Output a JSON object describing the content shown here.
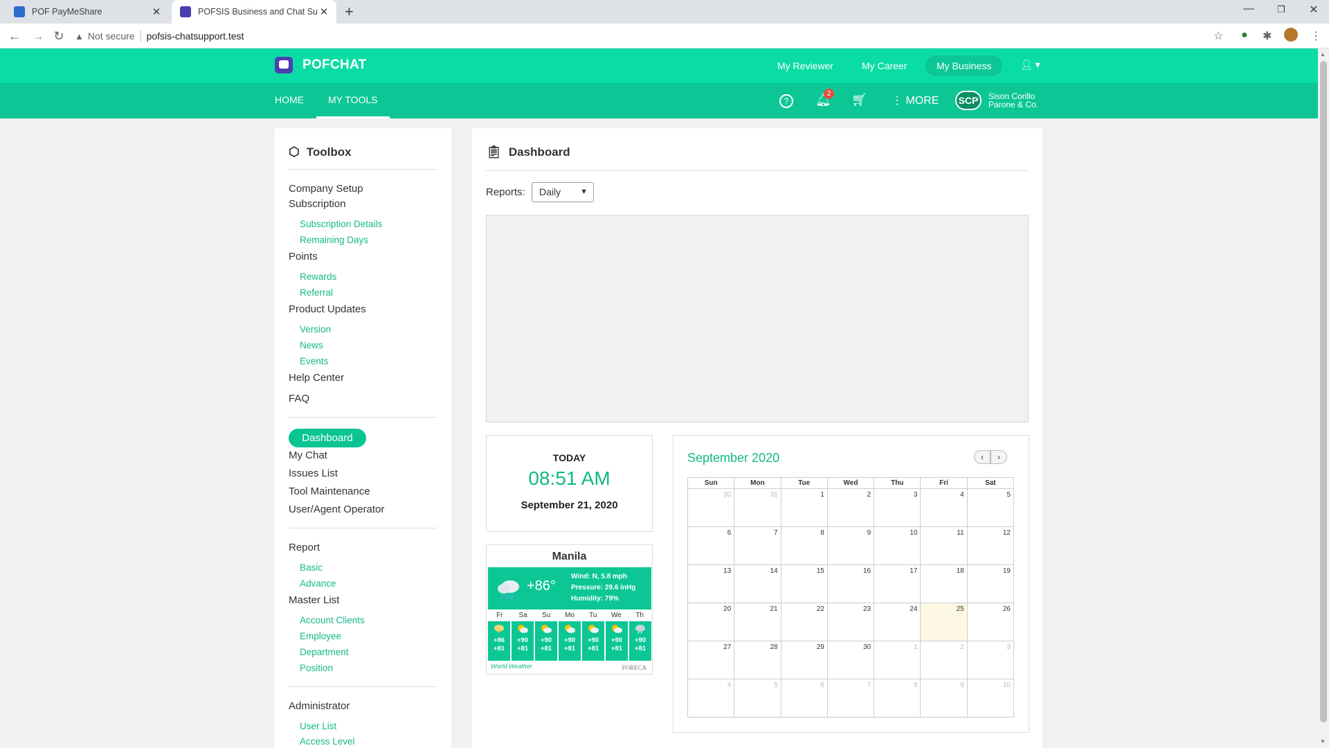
{
  "browser": {
    "tabs": [
      {
        "title": "POF PayMeShare"
      },
      {
        "title": "POFSIS Business and Chat Support"
      }
    ],
    "not_secure": "Not secure",
    "url": "pofsis-chatsupport.test"
  },
  "header": {
    "brand": "POFCHAT",
    "top_nav": [
      "My Reviewer",
      "My Career",
      "My Business"
    ],
    "sub_nav": [
      "HOME",
      "MY TOOLS"
    ],
    "notification_count": "2",
    "more": "MORE",
    "company_initials": "SCP",
    "company_name_1": "Sison Corillo",
    "company_name_2": "Parone & Co."
  },
  "sidebar": {
    "title": "Toolbox",
    "company_setup": "Company Setup",
    "subscription": "Subscription",
    "subscription_details": "Subscription Details",
    "remaining_days": "Remaining Days",
    "points": "Points",
    "rewards": "Rewards",
    "referral": "Referral",
    "product_updates": "Product Updates",
    "version": "Version",
    "news": "News",
    "events": "Events",
    "help_center": "Help Center",
    "faq": "FAQ",
    "dashboard": "Dashboard",
    "my_chat": "My Chat",
    "issues_list": "Issues List",
    "tool_maintenance": "Tool Maintenance",
    "user_agent_operator": "User/Agent Operator",
    "report": "Report",
    "basic": "Basic",
    "advance": "Advance",
    "master_list": "Master List",
    "account_clients": "Account Clients",
    "employee": "Employee",
    "department": "Department",
    "position": "Position",
    "administrator": "Administrator",
    "user_list": "User List",
    "access_level": "Access Level"
  },
  "main": {
    "title": "Dashboard",
    "reports_label": "Reports:",
    "reports_value": "Daily",
    "today_label": "TODAY",
    "today_time": "08:51 AM",
    "today_date": "September 21, 2020"
  },
  "weather": {
    "city": "Manila",
    "temp": "+86°",
    "wind": "Wind: N, 5.8 mph",
    "pressure": "Pressure: 29.6 inHg",
    "humidity": "Humidity: 79%",
    "days": [
      "Fr",
      "Sa",
      "Su",
      "Mo",
      "Tu",
      "We",
      "Th"
    ],
    "highs": [
      "+86",
      "+90",
      "+90",
      "+90",
      "+90",
      "+90",
      "+90"
    ],
    "lows": [
      "+81",
      "+81",
      "+81",
      "+81",
      "+81",
      "+81",
      "+81"
    ],
    "footer_left": "World Weather",
    "footer_right": "FORECA",
    "accent": "#0cc795"
  },
  "calendar": {
    "title": "September 2020",
    "weekdays": [
      "Sun",
      "Mon",
      "Tue",
      "Wed",
      "Thu",
      "Fri",
      "Sat"
    ],
    "weeks": [
      [
        "30",
        "31",
        "1",
        "2",
        "3",
        "4",
        "5"
      ],
      [
        "6",
        "7",
        "8",
        "9",
        "10",
        "11",
        "12"
      ],
      [
        "13",
        "14",
        "15",
        "16",
        "17",
        "18",
        "19"
      ],
      [
        "20",
        "21",
        "22",
        "23",
        "24",
        "25",
        "26"
      ],
      [
        "27",
        "28",
        "29",
        "30",
        "1",
        "2",
        "3"
      ],
      [
        "4",
        "5",
        "6",
        "7",
        "8",
        "9",
        "10"
      ]
    ]
  },
  "colors": {
    "header_top": "#0bdca6",
    "header_sub": "#0cc795",
    "accent_text": "#12b886",
    "today_highlight": "#fcf8e3"
  }
}
